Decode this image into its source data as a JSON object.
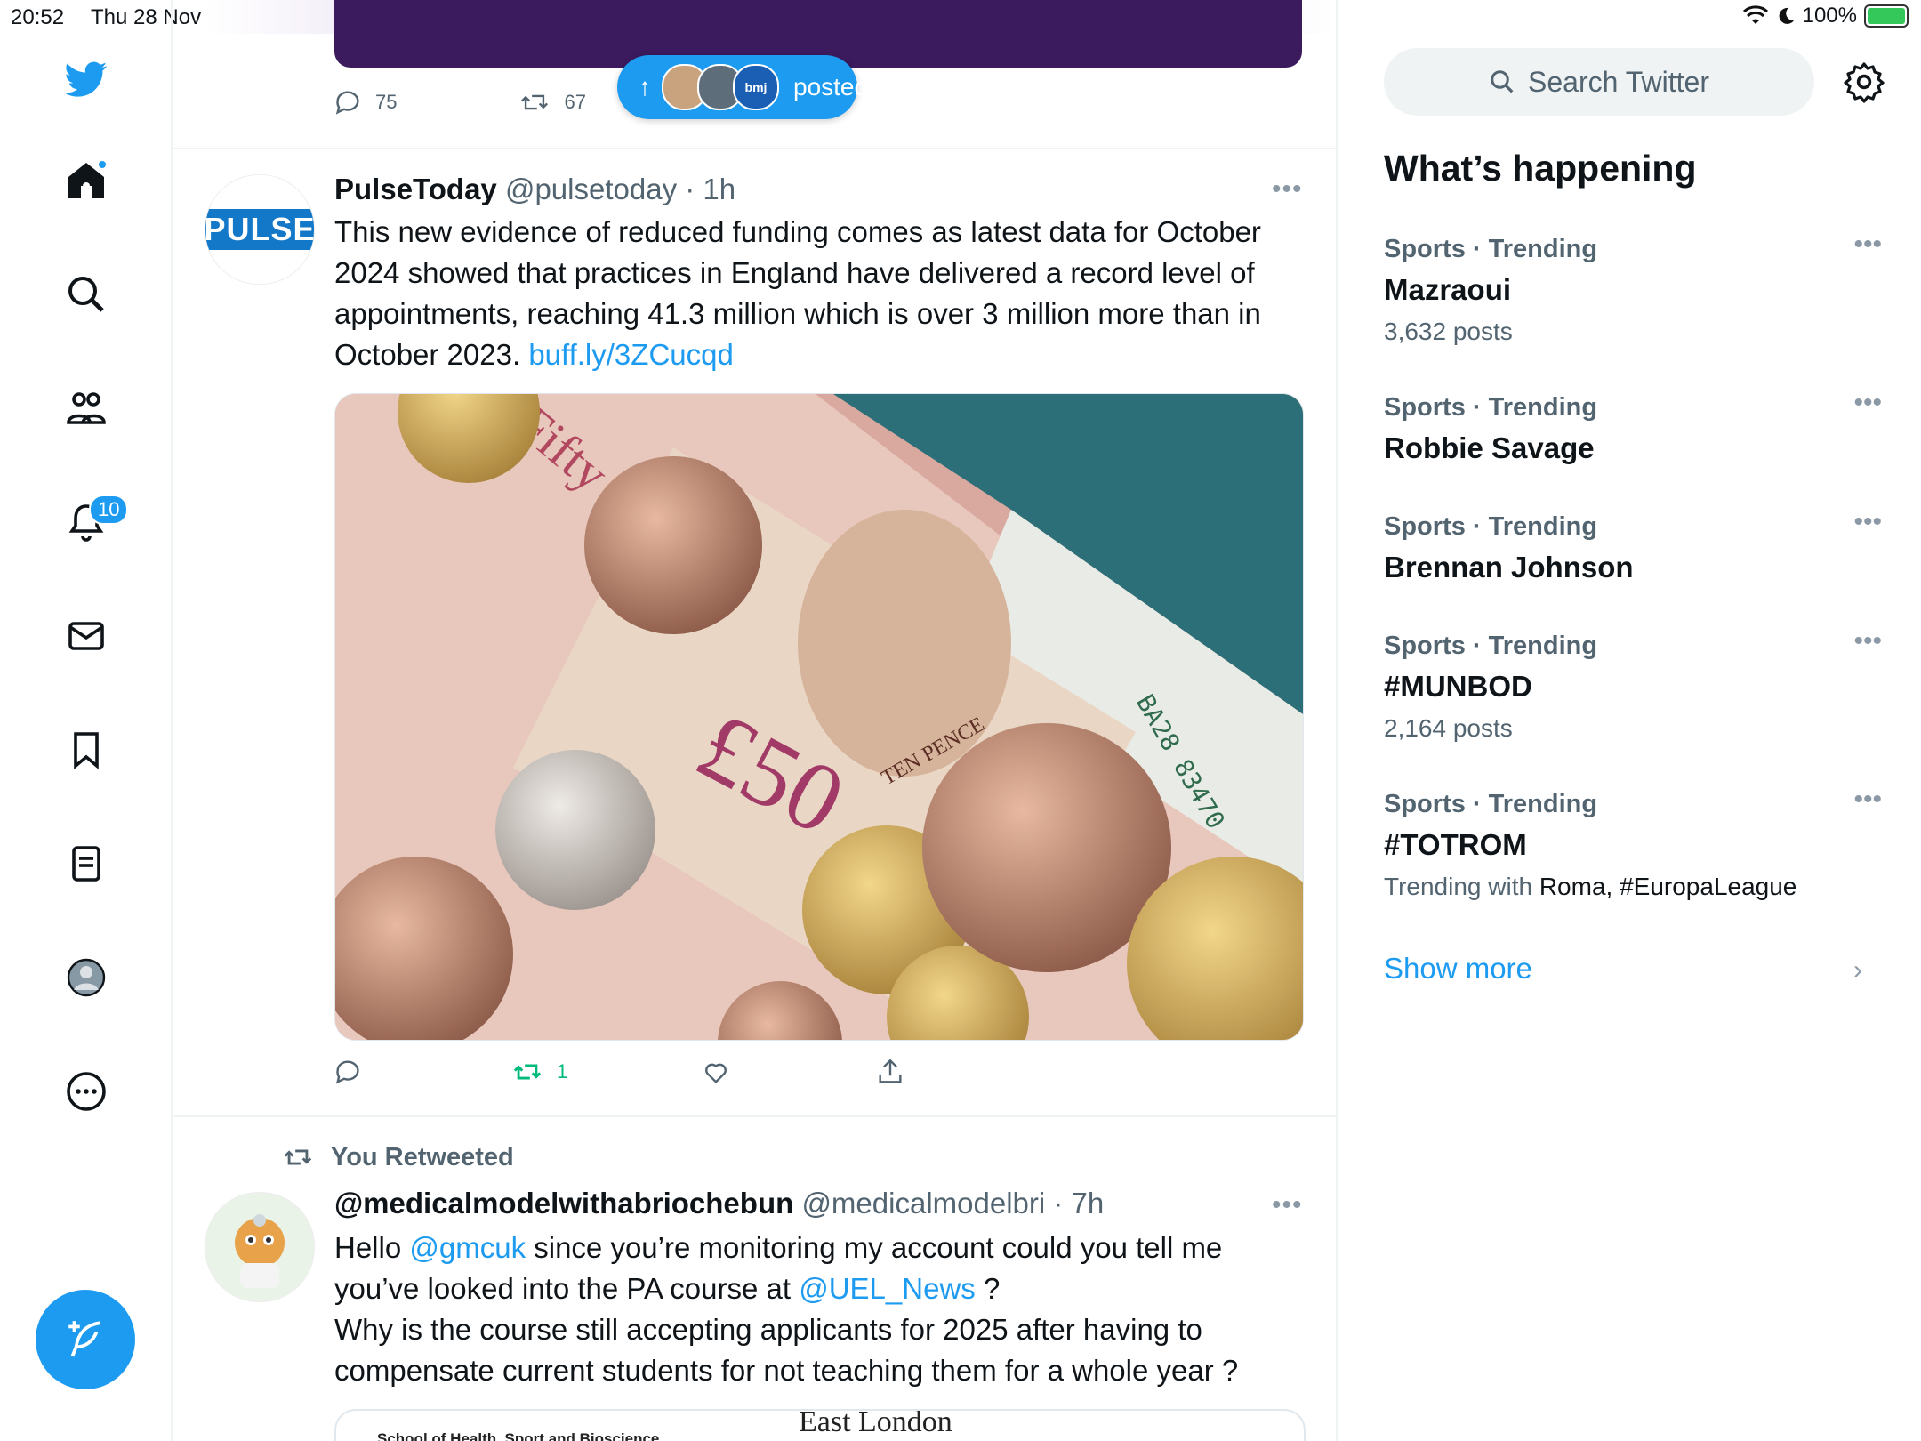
{
  "status_bar": {
    "time": "20:52",
    "date": "Thu 28 Nov",
    "battery": "100%"
  },
  "nav": {
    "notifications_badge": "10"
  },
  "prev_tweet": {
    "reply_count": "75",
    "retweet_count": "67"
  },
  "new_posts_pill": {
    "label": "posted",
    "avatar_text": "bmj"
  },
  "tweet1": {
    "name": "PulseToday",
    "handle": "@pulsetoday",
    "time": "· 1h",
    "avatar_text": "PULSE",
    "text": "This new evidence of reduced funding comes as latest data for October 2024 showed that practices in England have delivered a record level of appointments, reaching 41.3 million which is over 3 million more than in October 2023. ",
    "link": "buff.ly/3ZCucqd",
    "retweet_count": "1",
    "media_text": {
      "fifty": "£50",
      "pounds": "Fifty Pounds",
      "pence": "TEN PENCE",
      "serial": "BA28 83470"
    }
  },
  "tweet2": {
    "retweet_label": "You Retweeted",
    "name": "@medicalmodelwithabriochebun",
    "handle": "@medicalmodelbri",
    "time": "· 7h",
    "text_a": "Hello ",
    "mention1": "@gmcuk",
    "text_b": " since you’re monitoring my account could you tell me you’ve looked into the PA course at ",
    "mention2": "@UEL_News",
    "text_c": " ?",
    "text_d": "Why is the course still accepting applicants for 2025 after having to compensate current students for not teaching them for a whole year ?",
    "card_left": "School of Health, Sport and Bioscience",
    "card_right": "East London"
  },
  "sidebar": {
    "search_placeholder": "Search Twitter",
    "heading": "What’s happening",
    "trends": [
      {
        "meta": "Sports · Trending",
        "title": "Mazraoui",
        "sub": "3,632 posts"
      },
      {
        "meta": "Sports · Trending",
        "title": "Robbie Savage",
        "sub": ""
      },
      {
        "meta": "Sports · Trending",
        "title": "Brennan Johnson",
        "sub": ""
      },
      {
        "meta": "Sports · Trending",
        "title": "#MUNBOD",
        "sub": "2,164 posts"
      },
      {
        "meta": "Sports · Trending",
        "title": "#TOTROM",
        "sub_prefix": "Trending with ",
        "sub_items": "Roma, #EuropaLeague"
      }
    ],
    "show_more": "Show more"
  }
}
